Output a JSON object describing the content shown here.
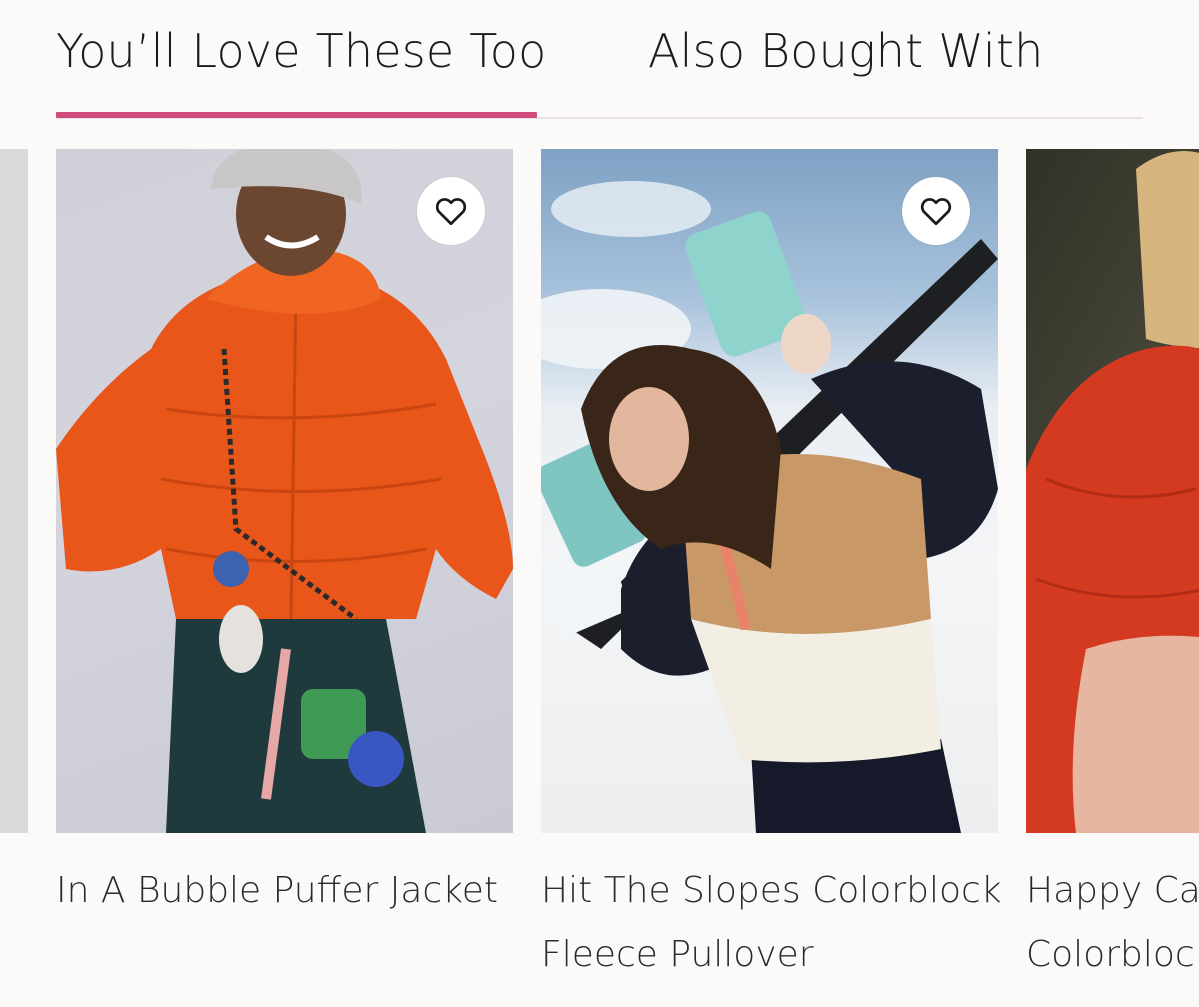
{
  "tabs": [
    {
      "label": "You’ll Love These Too",
      "active": true
    },
    {
      "label": "Also Bought With",
      "active": false
    }
  ],
  "accent_color": "#cf4d7c",
  "products": [
    {
      "title": "In A Bubble Puffer Jacket",
      "favorite_icon": "heart-outline-icon"
    },
    {
      "title": "Hit The Slopes Colorblock Fleece Pullover",
      "favorite_icon": "heart-outline-icon"
    },
    {
      "title": "Happy Camper Colorblock"
    }
  ]
}
